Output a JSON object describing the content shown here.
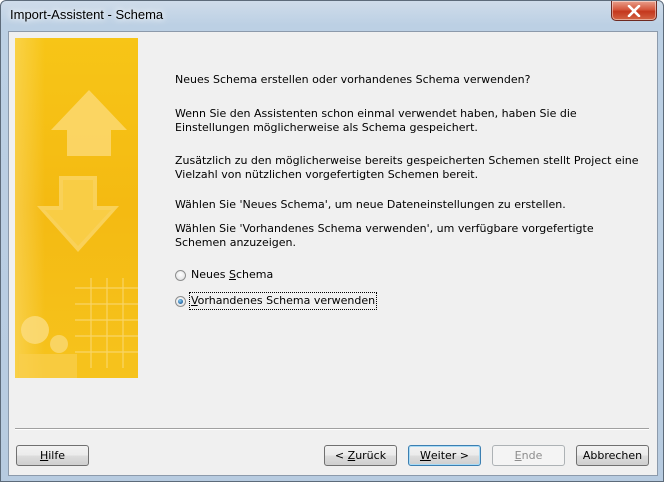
{
  "window": {
    "title": "Import-Assistent - Schema",
    "close_icon": "close-icon"
  },
  "content": {
    "heading": "Neues Schema erstellen oder vorhandenes Schema verwenden?",
    "para1": "Wenn Sie den Assistenten schon einmal verwendet haben, haben Sie die Einstellungen möglicherweise als Schema gespeichert.",
    "para2": "Zusätzlich zu den möglicherweise bereits gespeicherten Schemen stellt Project eine Vielzahl von nützlichen vorgefertigten Schemen bereit.",
    "para3": "Wählen Sie 'Neues Schema', um neue Dateneinstellungen zu erstellen.",
    "para4": "Wählen Sie 'Vorhandenes Schema verwenden', um verfügbare vorgefertigte Schemen anzuzeigen."
  },
  "options": {
    "new_schema": {
      "pre": "Neues ",
      "key": "S",
      "post": "chema",
      "selected": false
    },
    "existing_schema": {
      "pre": "",
      "key": "V",
      "post": "orhandenes Schema verwenden",
      "selected": true
    }
  },
  "buttons": {
    "help": {
      "pre": "",
      "key": "H",
      "post": "ilfe"
    },
    "back": {
      "pre": "< ",
      "key": "Z",
      "post": "urück"
    },
    "next": {
      "pre": "",
      "key": "W",
      "post": "eiter >"
    },
    "finish": {
      "pre": "",
      "key": "E",
      "post": "nde",
      "enabled": false
    },
    "cancel": {
      "pre": "",
      "key": "",
      "post": "Abbrechen"
    }
  },
  "colors": {
    "banner_yellow": "#f6c21a",
    "banner_light": "#fbe07e",
    "title_bar": "#c4d6ea",
    "close_red": "#c4371d"
  }
}
